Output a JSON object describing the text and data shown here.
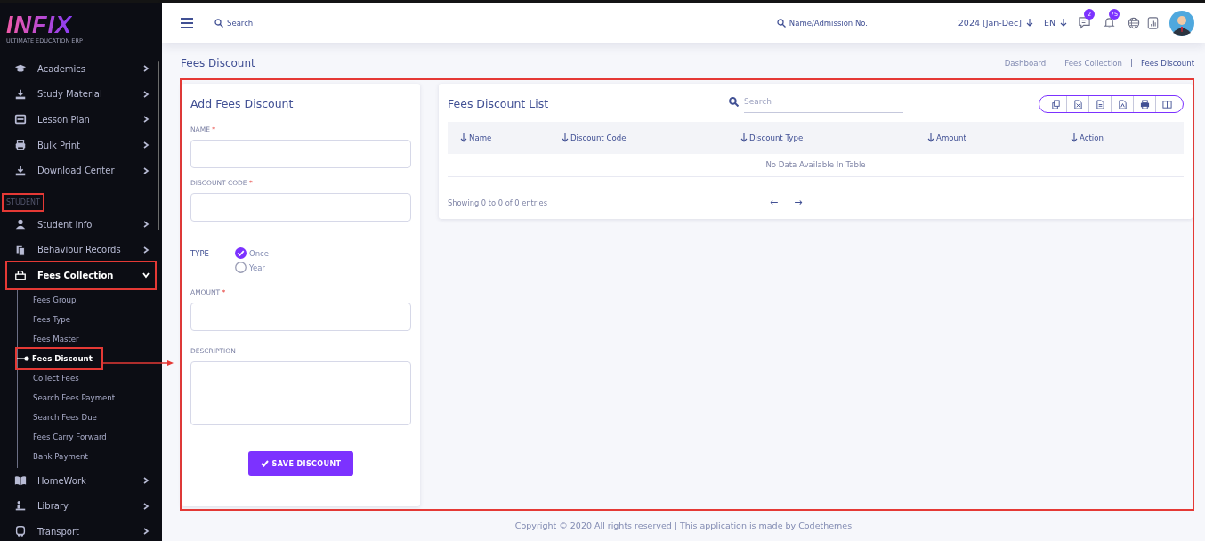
{
  "logo": {
    "mark": "INFIX",
    "tagline": "ULTIMATE EDUCATION ERP"
  },
  "sidebar": {
    "items": [
      {
        "kind": "menu",
        "label": "Academics",
        "expanded": false,
        "highlighted": false
      },
      {
        "kind": "menu",
        "label": "Study Material",
        "expanded": false,
        "highlighted": false
      },
      {
        "kind": "menu",
        "label": "Lesson Plan",
        "expanded": false,
        "highlighted": false
      },
      {
        "kind": "menu",
        "label": "Bulk Print",
        "expanded": false,
        "highlighted": false
      },
      {
        "kind": "menu",
        "label": "Download Center",
        "expanded": false,
        "highlighted": false
      },
      {
        "kind": "heading",
        "label": "STUDENT",
        "highlighted": true
      },
      {
        "kind": "menu",
        "label": "Student Info",
        "expanded": false,
        "highlighted": false
      },
      {
        "kind": "menu",
        "label": "Behaviour Records",
        "expanded": false,
        "highlighted": false
      },
      {
        "kind": "menu",
        "label": "Fees Collection",
        "expanded": true,
        "highlighted": true,
        "children": [
          {
            "label": "Fees Group",
            "selected": false,
            "highlighted": false
          },
          {
            "label": "Fees Type",
            "selected": false,
            "highlighted": false
          },
          {
            "label": "Fees Master",
            "selected": false,
            "highlighted": false
          },
          {
            "label": "Fees Discount",
            "selected": true,
            "highlighted": true
          },
          {
            "label": "Collect Fees",
            "selected": false,
            "highlighted": false
          },
          {
            "label": "Search Fees Payment",
            "selected": false,
            "highlighted": false
          },
          {
            "label": "Search Fees Due",
            "selected": false,
            "highlighted": false
          },
          {
            "label": "Fees Carry Forward",
            "selected": false,
            "highlighted": false
          },
          {
            "label": "Bank Payment",
            "selected": false,
            "highlighted": false
          }
        ]
      },
      {
        "kind": "menu",
        "label": "HomeWork",
        "expanded": false,
        "highlighted": false
      },
      {
        "kind": "menu",
        "label": "Library",
        "expanded": false,
        "highlighted": false
      },
      {
        "kind": "menu",
        "label": "Transport",
        "expanded": false,
        "highlighted": false
      }
    ]
  },
  "topbar": {
    "search": {
      "placeholder": "Search"
    },
    "student_search": {
      "placeholder": "Name/Admission No."
    },
    "session": "2024 [Jan-Dec]",
    "language": "EN",
    "messages_badge": "2",
    "notifications_badge": "75"
  },
  "page": {
    "title": "Fees Discount",
    "breadcrumb": [
      {
        "label": "Dashboard",
        "current": false
      },
      {
        "label": "Fees Collection",
        "current": false
      },
      {
        "label": "Fees Discount",
        "current": true
      }
    ]
  },
  "content": {
    "highlighted": true,
    "annotation_arrow": true
  },
  "form": {
    "title": "Add Fees Discount",
    "fields": [
      {
        "kind": "text",
        "label": "NAME",
        "required_mark": "*"
      },
      {
        "kind": "text",
        "label": "DISCOUNT CODE",
        "required_mark": "*"
      },
      {
        "kind": "radio",
        "label": "TYPE",
        "options": [
          {
            "label": "Once",
            "selected": true
          },
          {
            "label": "Year",
            "selected": false
          }
        ]
      },
      {
        "kind": "text",
        "label": "AMOUNT",
        "required_mark": "*"
      },
      {
        "kind": "textarea",
        "label": "DESCRIPTION"
      }
    ],
    "submit": "SAVE DISCOUNT"
  },
  "list": {
    "title": "Fees Discount List",
    "search": {
      "placeholder": "Search"
    },
    "columns": [
      "Name",
      "Discount Code",
      "Discount Type",
      "Amount",
      "Action"
    ],
    "empty_message": "No Data Available In Table",
    "info": "Showing 0 to 0 of 0 entries",
    "prev": "←",
    "next": "→"
  },
  "footer": "Copyright © 2020 All rights reserved | This application is made by Codethemes"
}
